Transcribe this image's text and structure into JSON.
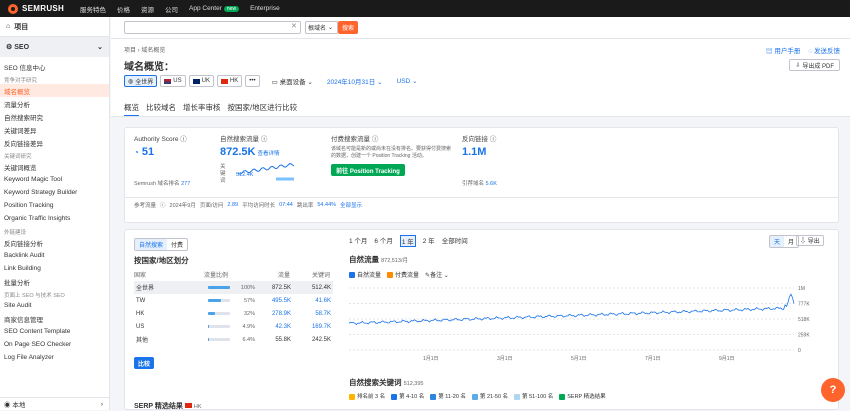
{
  "topbar": {
    "logo": "SEMRUSH",
    "nav": [
      "服务特色",
      "价格",
      "资源",
      "公司",
      "App Center",
      "Enterprise"
    ],
    "new_badge": "new"
  },
  "sidebar": {
    "projects": "项目",
    "seo": "SEO",
    "seo_home": "SEO 信息中心",
    "sections": [
      {
        "title": "竞争对手研究",
        "items": [
          "域名概览",
          "流量分析",
          "自然搜索研究",
          "关键词差异",
          "反向链接差异"
        ]
      },
      {
        "title": "关键词研究",
        "items": [
          "关键词概览",
          "Keyword Magic Tool",
          "Keyword Strategy Builder",
          "Position Tracking",
          "Organic Traffic Insights"
        ]
      },
      {
        "title": "外链建设",
        "items": [
          "反向链接分析",
          "Backlink Audit",
          "Link Building",
          "批量分析"
        ]
      },
      {
        "title": "页面上 SEO 与技术 SEO",
        "items": [
          "Site Audit",
          "商家信息管理",
          "SEO Content Template",
          "On Page SEO Checker",
          "Log File Analyzer"
        ]
      }
    ],
    "footer": "本地"
  },
  "search": {
    "mode": "根域名",
    "button": "搜索"
  },
  "breadcrumb": {
    "root": "项目",
    "current": "域名概览"
  },
  "links": {
    "manual": "用户手册",
    "feedback": "发送反馈"
  },
  "title": "域名概览：",
  "pdf": "导出成 PDF",
  "databases": [
    {
      "label": "全世界",
      "active": true
    },
    {
      "label": "US"
    },
    {
      "label": "UK"
    },
    {
      "label": "HK"
    }
  ],
  "device": "桌面设备",
  "date": "2024年10月31日",
  "currency": "USD",
  "tabs": [
    "概览",
    "比较域名",
    "增长率审核",
    "按国家/地区进行比较"
  ],
  "metrics": {
    "authority": {
      "label": "Authority Score",
      "value": "51",
      "rank_label": "Semrush 域名排名",
      "rank": "277"
    },
    "organic": {
      "label": "自然搜索流量",
      "value": "872.5K",
      "link": "查看详情",
      "kw_label": "关键词",
      "kw": "512.4K"
    },
    "paid": {
      "label": "付费搜索流量",
      "desc": "该域名可能是新的或尚未在没有排名。要获得付费搜索的数据，创建一个 Position Tracking 活动。",
      "button": "前往 Position Tracking"
    },
    "backlinks": {
      "label": "反向链接",
      "value": "1.1M",
      "ref_label": "引荐域名",
      "ref": "5.6K"
    }
  },
  "trafficbar": {
    "label": "参考流量",
    "month": "2024年9月",
    "pv_label": "页面/访问",
    "pv": "2.89",
    "dur_label": "平均访问时长",
    "dur": "07:44",
    "bounce_label": "跳出率",
    "bounce": "54.44%",
    "all": "全部显示"
  },
  "country": {
    "toggle": [
      "自然搜索",
      "付费"
    ],
    "title": "按国家/地区划分",
    "headers": [
      "国家",
      "流量比例",
      "流量",
      "关键词"
    ],
    "rows": [
      {
        "name": "全世界",
        "share": "100%",
        "pct": 100,
        "traffic": "872.5K",
        "kw": "512.4K"
      },
      {
        "name": "TW",
        "share": "57%",
        "pct": 57,
        "traffic": "495.5K",
        "kw": "41.6K"
      },
      {
        "name": "HK",
        "share": "32%",
        "pct": 32,
        "traffic": "278.9K",
        "kw": "58.7K"
      },
      {
        "name": "US",
        "share": "4.9%",
        "pct": 4.9,
        "traffic": "42.3K",
        "kw": "169.7K"
      },
      {
        "name": "其他",
        "share": "6.4%",
        "pct": 6.4,
        "traffic": "55.8K",
        "kw": "242.5K"
      }
    ],
    "compare": "比较",
    "serp": "SERP 精选结果",
    "serp_db": "HK"
  },
  "trend": {
    "ranges": [
      "1 个月",
      "6 个月",
      "1 年",
      "2 年",
      "全部时间"
    ],
    "granularity": [
      "天",
      "月"
    ],
    "export": "导出",
    "title": "自然流量",
    "title_val": "872,513/月",
    "legend": [
      "自然流量",
      "付费流量",
      "备注"
    ],
    "yticks": [
      "1M",
      "777K",
      "518K",
      "259K",
      "0"
    ],
    "xticks": [
      "1月1日",
      "3月1日",
      "5月1日",
      "7月1日",
      "9月1日"
    ]
  },
  "kwsection": {
    "title": "自然搜索关键词",
    "value": "512,395",
    "legend": [
      "排名前 3 名",
      "第 4-10 名",
      "第 11-20 名",
      "第 21-50 名",
      "第 51-100 名",
      "SERP 精选结果"
    ]
  },
  "colors": {
    "accent": "#ff642d",
    "blue": "#1a73e8",
    "green": "#00a855"
  },
  "chart_data": {
    "type": "line",
    "x": [
      "1月1日",
      "3月1日",
      "5月1日",
      "7月1日",
      "9月1日"
    ],
    "series": [
      {
        "name": "自然流量",
        "values": [
          430000,
          500000,
          530000,
          580000,
          680000
        ]
      }
    ],
    "ylim": [
      0,
      1000000
    ],
    "grid": true
  }
}
